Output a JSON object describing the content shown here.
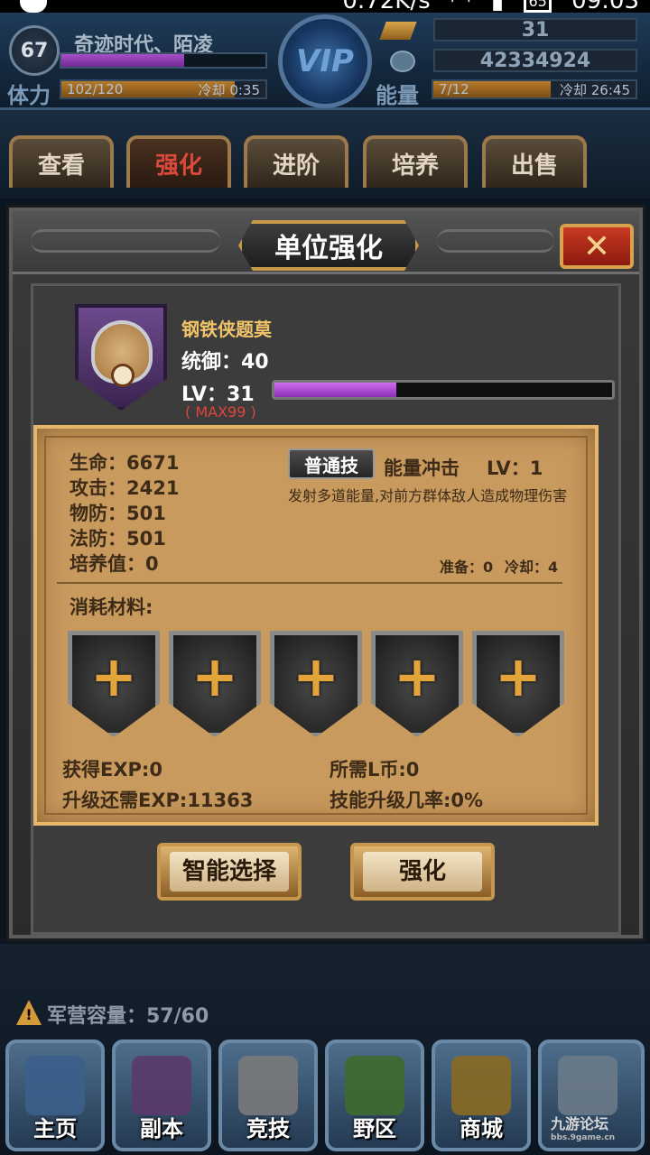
{
  "status_bar": {
    "speed": "0.72K/s",
    "battery": "65",
    "time": "09:03"
  },
  "hud": {
    "player_level": "67",
    "player_name": "奇迹时代、陌凌",
    "exp_fraction": 0.6,
    "vip_label": "VIP",
    "stamina_label": "体力",
    "stamina_value": "102/120",
    "stamina_cooldown": "冷却 0:35",
    "stamina_fraction": 0.85,
    "energy_label": "能量",
    "energy_value": "7/12",
    "energy_cooldown": "冷却 26:45",
    "energy_fraction": 0.58,
    "gems": "31",
    "coins": "42334924"
  },
  "tabs": [
    {
      "label": "查看"
    },
    {
      "label": "强化"
    },
    {
      "label": "进阶"
    },
    {
      "label": "培养"
    },
    {
      "label": "出售"
    }
  ],
  "modal": {
    "title": "单位强化",
    "close_label": "✕",
    "hero": {
      "name": "钢铁侠题莫",
      "command": "统御：40",
      "level": "LV：31",
      "max": "( MAX99 )",
      "level_fraction": 0.36
    },
    "stats": {
      "hp": "生命：6671",
      "atk": "攻击：2421",
      "pdef": "物防：501",
      "mdef": "法防：501",
      "train": "培养值：0"
    },
    "skill": {
      "type_button": "普通技",
      "name": "能量冲击",
      "level": "LV：1",
      "description": "发射多道能量,对前方群体敌人造成物理伤害",
      "prep": "准备：0",
      "cooldown": "冷却：4"
    },
    "materials_label": "消耗材料:",
    "slot_symbol": "+",
    "gain_exp": "获得EXP:0",
    "need_coin": "所需L币:0",
    "need_exp": "升级还需EXP:11363",
    "skill_rate": "技能升级几率:0%",
    "auto_select_label": "智能选择",
    "enhance_label": "强化"
  },
  "barracks": "军营容量：57/60",
  "warning_symbol": "!",
  "nav": [
    {
      "label": "主页",
      "color": "#3b5f8a"
    },
    {
      "label": "副本",
      "color": "#5a3a6a"
    },
    {
      "label": "竞技",
      "color": "#7a7a7a"
    },
    {
      "label": "野区",
      "color": "#3e6a2e"
    },
    {
      "label": "商城",
      "color": "#8a6a22"
    },
    {
      "label": "",
      "color": "#6a7a8a"
    }
  ],
  "watermark": {
    "brand": "九游论坛",
    "url": "bbs.9game.cn"
  }
}
